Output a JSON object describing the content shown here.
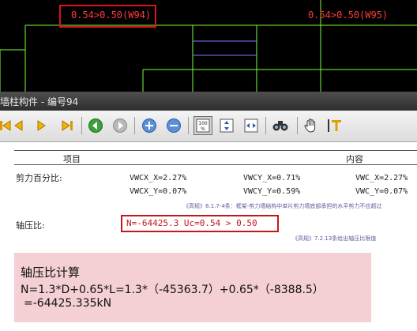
{
  "canvas": {
    "label_left": "0.54>0.50(W94)",
    "label_right": "0.54>0.50(W95)",
    "label_color": "#ff3b3b",
    "line_color": "#7cff3a",
    "wall_line_color": "#7a7aff"
  },
  "window": {
    "title": "墙柱构件 - 编号94"
  },
  "toolbar": {
    "icons": [
      "first-page-icon",
      "prev-page-icon",
      "next-page-icon",
      "last-page-icon",
      "back-icon",
      "forward-icon",
      "zoom-in-icon",
      "zoom-out-icon",
      "actual-size-icon",
      "fit-page-icon",
      "fit-width-icon",
      "find-icon",
      "hand-tool-icon",
      "text-select-icon"
    ],
    "actual_size_label": "100"
  },
  "table": {
    "col_item": "项目",
    "col_content": "内容",
    "shear_label": "剪力百分比:",
    "shear_row1": [
      "VWCX_X=2.27%",
      "VWCY_X=0.71%",
      "VWC_X=2.27%"
    ],
    "shear_row2": [
      "VWCX_Y=0.07%",
      "VWCY_Y=0.59%",
      "VWC_Y=0.07%"
    ],
    "shear_note": "《高规》8.1.7-4条：框架-剪力墙结构中单片剪力墙底部承担的水平剪力不应超过",
    "axial_label": "轴压比:",
    "axial_value": "N=-64425.3    Uc=0.54 > 0.50",
    "axial_note": "《高规》7.2.13条给出轴压比限值"
  },
  "calc": {
    "title": "轴压比计算",
    "formula": "N=1.3*D+0.65*L=1.3*（-45363.7）+0.65*（-8388.5）",
    "result": "=-64425.335kN",
    "bg": "#f4cfd4"
  }
}
